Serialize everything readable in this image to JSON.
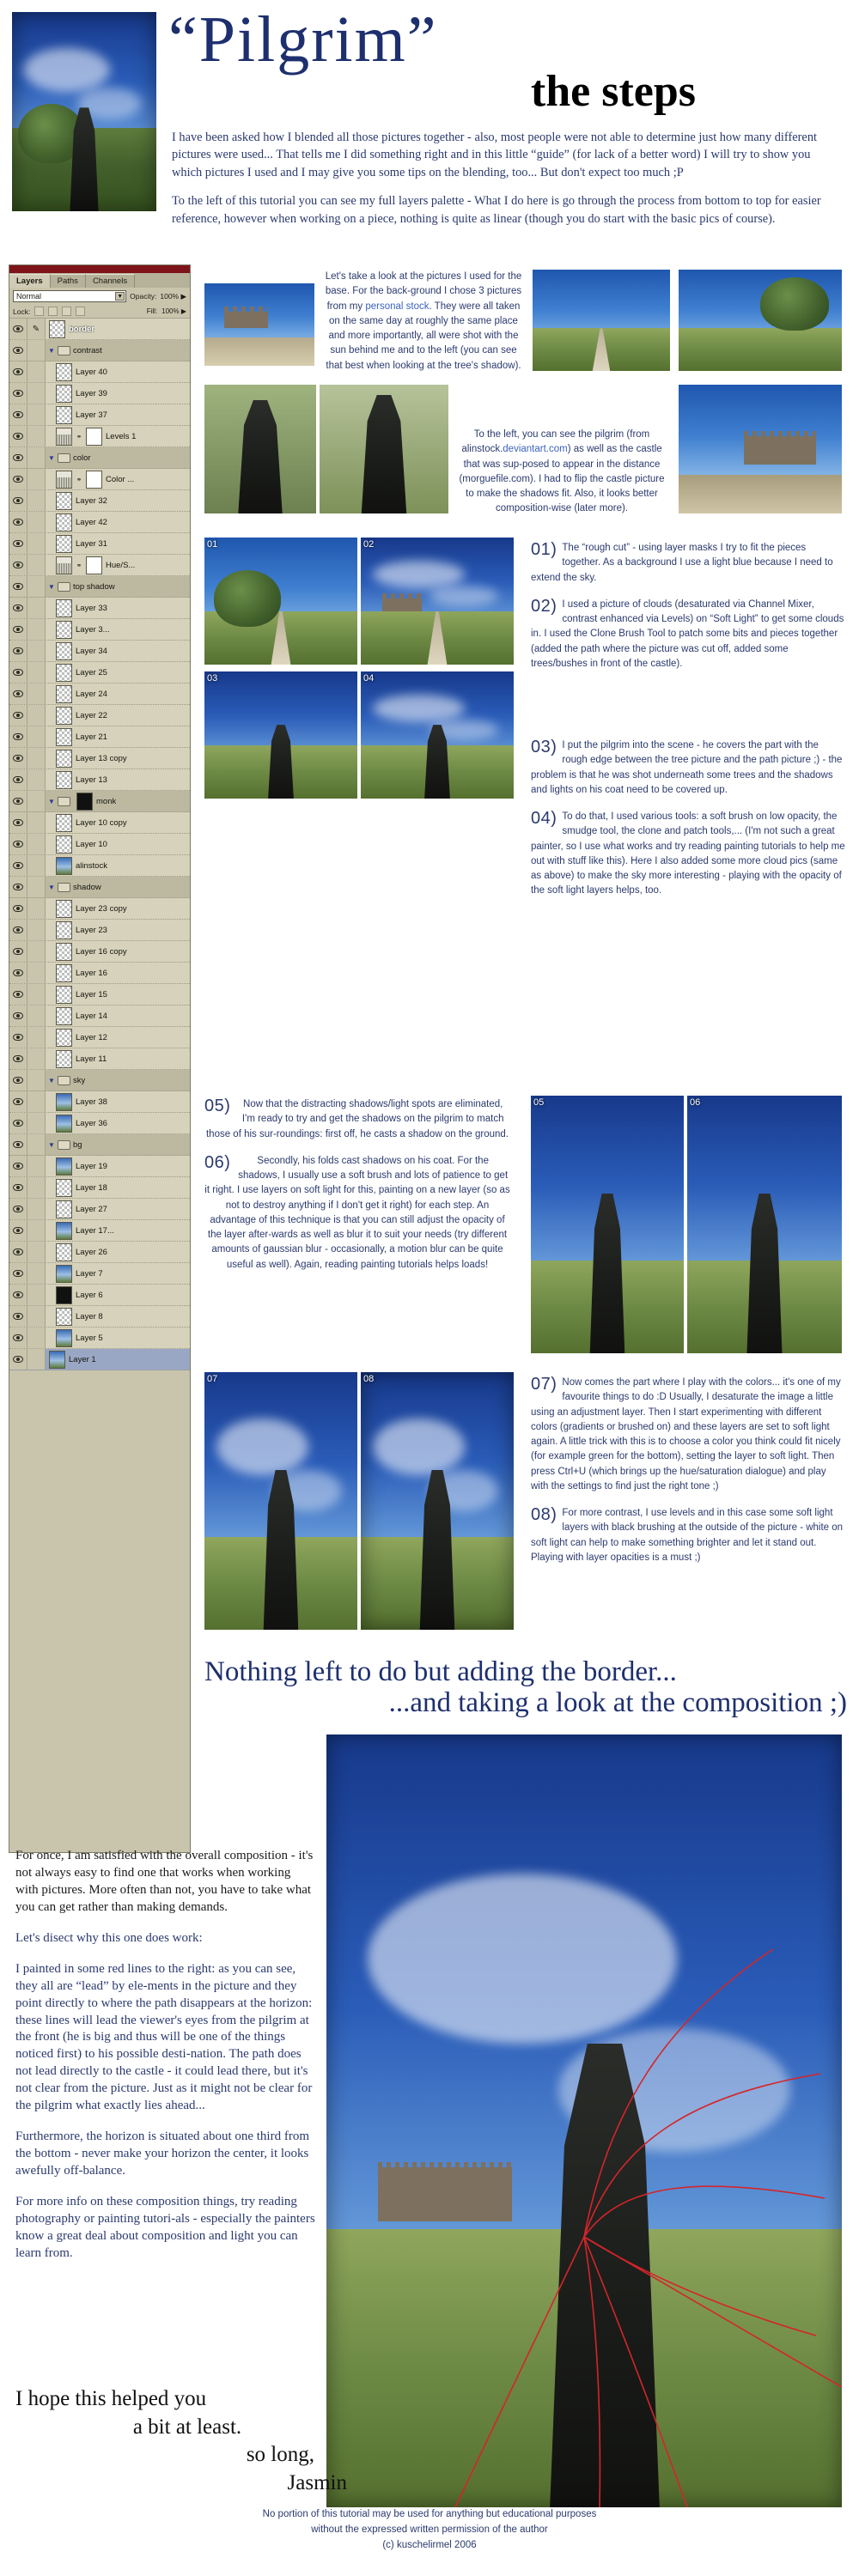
{
  "header": {
    "title_main": "“Pilgrim”",
    "title_sub": "the steps",
    "intro_p1": "I have been asked how I blended all those pictures together - also, most people were not able to determine just how many different pictures were used... That tells me I did something right and in this little “guide” (for lack of a better word) I will try to show you which pictures I used and I may give you some tips on the blending, too... But don't expect too much ;P",
    "intro_p2": "To the left of this tutorial you can see my full layers palette - What I do here is go through the process from bottom to top for easier reference, however when working on a piece, nothing is quite as linear (though you do start with the basic pics of course)."
  },
  "layers_panel": {
    "tabs": [
      "Layers",
      "Paths",
      "Channels"
    ],
    "blend_mode": "Normal",
    "opacity_label": "Opacity:",
    "opacity_value": "100% ▶",
    "fill_label": "Fill:",
    "fill_value": "100% ▶",
    "lock_label": "Lock:",
    "lock_icons": [
      "transparency-lock",
      "paint-lock",
      "move-lock",
      "all-lock"
    ],
    "rows": [
      {
        "name": "border",
        "type": "layer",
        "thumb": "checker",
        "selected": false,
        "bold": true
      },
      {
        "name": "contrast",
        "type": "group",
        "open": true
      },
      {
        "name": "Layer 40",
        "type": "layer",
        "thumb": "checker",
        "indent": 1
      },
      {
        "name": "Layer 39",
        "type": "layer",
        "thumb": "checker",
        "indent": 1
      },
      {
        "name": "Layer 37",
        "type": "layer",
        "thumb": "checker",
        "indent": 1
      },
      {
        "name": "Levels 1",
        "type": "adjustment",
        "thumb": "adj",
        "indent": 1
      },
      {
        "name": "color",
        "type": "group",
        "open": true
      },
      {
        "name": "Color ...",
        "type": "adjustment",
        "thumb": "wheel",
        "indent": 1
      },
      {
        "name": "Layer 32",
        "type": "layer",
        "thumb": "checker",
        "indent": 1
      },
      {
        "name": "Layer 42",
        "type": "layer",
        "thumb": "checker",
        "indent": 1
      },
      {
        "name": "Layer 31",
        "type": "layer",
        "thumb": "checker",
        "indent": 1
      },
      {
        "name": "Hue/S...",
        "type": "adjustment",
        "thumb": "adj",
        "indent": 1
      },
      {
        "name": "top shadow",
        "type": "group",
        "open": true
      },
      {
        "name": "Layer 33",
        "type": "layer",
        "thumb": "checker",
        "indent": 1
      },
      {
        "name": "Layer 3...",
        "type": "layer",
        "thumb": "checker",
        "indent": 1
      },
      {
        "name": "Layer 34",
        "type": "layer",
        "thumb": "checker",
        "indent": 1
      },
      {
        "name": "Layer 25",
        "type": "layer",
        "thumb": "checker",
        "indent": 1
      },
      {
        "name": "Layer 24",
        "type": "layer",
        "thumb": "checker",
        "indent": 1
      },
      {
        "name": "Layer 22",
        "type": "layer",
        "thumb": "checker",
        "indent": 1
      },
      {
        "name": "Layer 21",
        "type": "layer",
        "thumb": "checker",
        "indent": 1
      },
      {
        "name": "Layer 13 copy",
        "type": "layer",
        "thumb": "checker",
        "indent": 1
      },
      {
        "name": "Layer 13",
        "type": "layer",
        "thumb": "checker",
        "indent": 1
      },
      {
        "name": "monk",
        "type": "group",
        "open": true,
        "thumb": "black"
      },
      {
        "name": "Layer 10 copy",
        "type": "layer",
        "thumb": "checker",
        "indent": 1
      },
      {
        "name": "Layer 10",
        "type": "layer",
        "thumb": "checker",
        "indent": 1
      },
      {
        "name": "alinstock",
        "type": "layer",
        "thumb": "photo",
        "indent": 1
      },
      {
        "name": "shadow",
        "type": "group",
        "open": true
      },
      {
        "name": "Layer 23 copy",
        "type": "layer",
        "thumb": "checker",
        "indent": 1
      },
      {
        "name": "Layer 23",
        "type": "layer",
        "thumb": "checker",
        "indent": 1
      },
      {
        "name": "Layer 16 copy",
        "type": "layer",
        "thumb": "checker",
        "indent": 1
      },
      {
        "name": "Layer 16",
        "type": "layer",
        "thumb": "checker",
        "indent": 1
      },
      {
        "name": "Layer 15",
        "type": "layer",
        "thumb": "checker",
        "indent": 1
      },
      {
        "name": "Layer 14",
        "type": "layer",
        "thumb": "checker",
        "indent": 1
      },
      {
        "name": "Layer 12",
        "type": "layer",
        "thumb": "checker",
        "indent": 1
      },
      {
        "name": "Layer 11",
        "type": "layer",
        "thumb": "checker",
        "indent": 1
      },
      {
        "name": "sky",
        "type": "group",
        "open": true
      },
      {
        "name": "Layer 38",
        "type": "layer",
        "thumb": "photo",
        "indent": 1
      },
      {
        "name": "Layer 36",
        "type": "layer",
        "thumb": "photo",
        "indent": 1
      },
      {
        "name": "bg",
        "type": "group",
        "open": true
      },
      {
        "name": "Layer 19",
        "type": "layer",
        "thumb": "photo",
        "indent": 1
      },
      {
        "name": "Layer 18",
        "type": "layer",
        "thumb": "checker",
        "indent": 1
      },
      {
        "name": "Layer 27",
        "type": "layer",
        "thumb": "checker",
        "indent": 1
      },
      {
        "name": "Layer 17...",
        "type": "layer",
        "thumb": "photo",
        "indent": 1
      },
      {
        "name": "Layer 26",
        "type": "layer",
        "thumb": "checker",
        "indent": 1
      },
      {
        "name": "Layer 7",
        "type": "layer",
        "thumb": "photo",
        "indent": 1
      },
      {
        "name": "Layer 6",
        "type": "layer",
        "thumb": "black",
        "indent": 1
      },
      {
        "name": "Layer 8",
        "type": "layer",
        "thumb": "checker",
        "indent": 1
      },
      {
        "name": "Layer 5",
        "type": "layer",
        "thumb": "photo",
        "indent": 1
      },
      {
        "name": "Layer 1",
        "type": "layer",
        "thumb": "photo",
        "selected": true
      }
    ]
  },
  "source_notes": {
    "note1_pre": "Let's take a look at the pictures I used for the base. For the back-ground I chose 3 pictures from my ",
    "note1_link": "personal stock",
    "note1_post": ". They were all taken on the same day at roughly the same place and more importantly, all were shot with the sun behind me and to the left (you can see that best when looking at the tree's shadow).",
    "note2_pre": "To the left, you can see the pilgrim (from alinstock.",
    "note2_link": "deviantart.com",
    "note2_post": ") as well as the castle that was sup-posed to appear in the distance (morguefile.com). I had to flip the castle picture to make the shadows fit. Also, it looks better composition-wise (later more)."
  },
  "steps": [
    {
      "num": "01)",
      "text": "The “rough cut” - using layer masks I try to fit the pieces together. As a background I use a light blue because I need to extend the sky."
    },
    {
      "num": "02)",
      "text": "I used a picture of clouds (desaturated via Channel Mixer, contrast enhanced via Levels) on “Soft Light” to get some clouds in. I used the Clone Brush Tool to patch some bits and pieces together (added the path where the picture was cut off, added some trees/bushes in front of the castle)."
    },
    {
      "num": "03)",
      "text": "I put the pilgrim into the scene - he covers the part with the rough edge between the tree picture and the path picture ;) - the problem is that he was shot underneath some trees and the shadows and lights on his coat need to be covered up."
    },
    {
      "num": "04)",
      "text": "To do that, I used various tools: a soft brush on low opacity, the smudge tool, the clone and patch tools,... (I'm not such a great painter, so I use what works and try reading painting tutorials to help me out with stuff like this). Here I also added some more cloud pics (same as above) to make the sky more interesting - playing with the opacity of the soft light layers helps, too."
    },
    {
      "num": "05)",
      "text": "Now that the distracting shadows/light spots are eliminated, I'm ready to try and get the shadows on the pilgrim to match those of his sur-roundings: first off, he casts a shadow on the ground."
    },
    {
      "num": "06)",
      "text": "Secondly, his folds cast shadows on his coat. For the shadows, I usually use a soft brush and lots of patience to get it right. I use layers on soft light for this, painting on a new layer (so as not to destroy anything if I don't get it right) for each step. An advantage of this technique is that you can still adjust the opacity of the layer after-wards as well as blur it to suit your needs (try different amounts of gaussian blur - occasionally, a motion blur can be quite useful as well). Again, reading painting tutorials helps loads!"
    },
    {
      "num": "07)",
      "text": "Now comes the part where I play with the colors... it's one of my favourite things to do :D Usually, I desaturate the image a little using an adjustment layer. Then I start experimenting with different colors (gradients or brushed on) and these layers are set to soft light again. A little trick with this is to choose a color you think could fit nicely (for example green for the bottom), setting the layer to soft light. Then press Ctrl+U (which brings up the hue/saturation dialogue) and play with the settings to find just the right tone ;)"
    },
    {
      "num": "08)",
      "text": "For more contrast, I use levels and in this case some soft light layers with black brushing at the outside of the picture - white on soft light can help to make something brighter and let it stand out. Playing with layer opacities is a must ;)"
    }
  ],
  "thumb_labels": [
    "01",
    "02",
    "03",
    "04",
    "05",
    "06",
    "07",
    "08"
  ],
  "midline": {
    "line1": "Nothing left to do but adding the border...",
    "line2": "...and taking a look at the composition ;)"
  },
  "composition": {
    "p1": "For once, I am satisfied with the overall composition - it's not always easy to find one that works when working with pictures. More often than not, you have to take what you can get rather than making demands.",
    "p2": "Let's disect why this one does work:",
    "p3": "I painted in some red lines to the right: as you can see, they all are “lead” by ele-ments in the picture and they point directly to where the path disappears at the horizon: these lines will lead the viewer's eyes from the pilgrim at the front (he is big and thus will be one of the things noticed first) to his possible desti-nation. The path does not lead directly to the castle - it could lead there, but it's not clear from the picture. Just as it might not be clear for the pilgrim what exactly lies ahead...",
    "p4": "Furthermore, the horizon is situated about one third from the bottom - never make your horizon the center, it looks awefully off-balance.",
    "p5": "For more info on these composition things, try reading photography or painting tutori-als - especially the painters know a great deal about composition and light you can learn from."
  },
  "signoff": {
    "l1": "I hope this helped you",
    "l2": "a bit at least.",
    "l3": "so long,",
    "l4": "Jasmin"
  },
  "footer": {
    "l1": "No portion of this tutorial may be used for anything but educational purposes",
    "l2": "without the expressed written permission of the author",
    "l3": "(c) kuschelirmel 2006"
  },
  "colors": {
    "title_blue": "#1d2f6e",
    "text_blue": "#2b3a6e",
    "link_blue": "#3b63c0",
    "panel_bg": "#c9c5ad",
    "red_lines": "#d4252a"
  }
}
